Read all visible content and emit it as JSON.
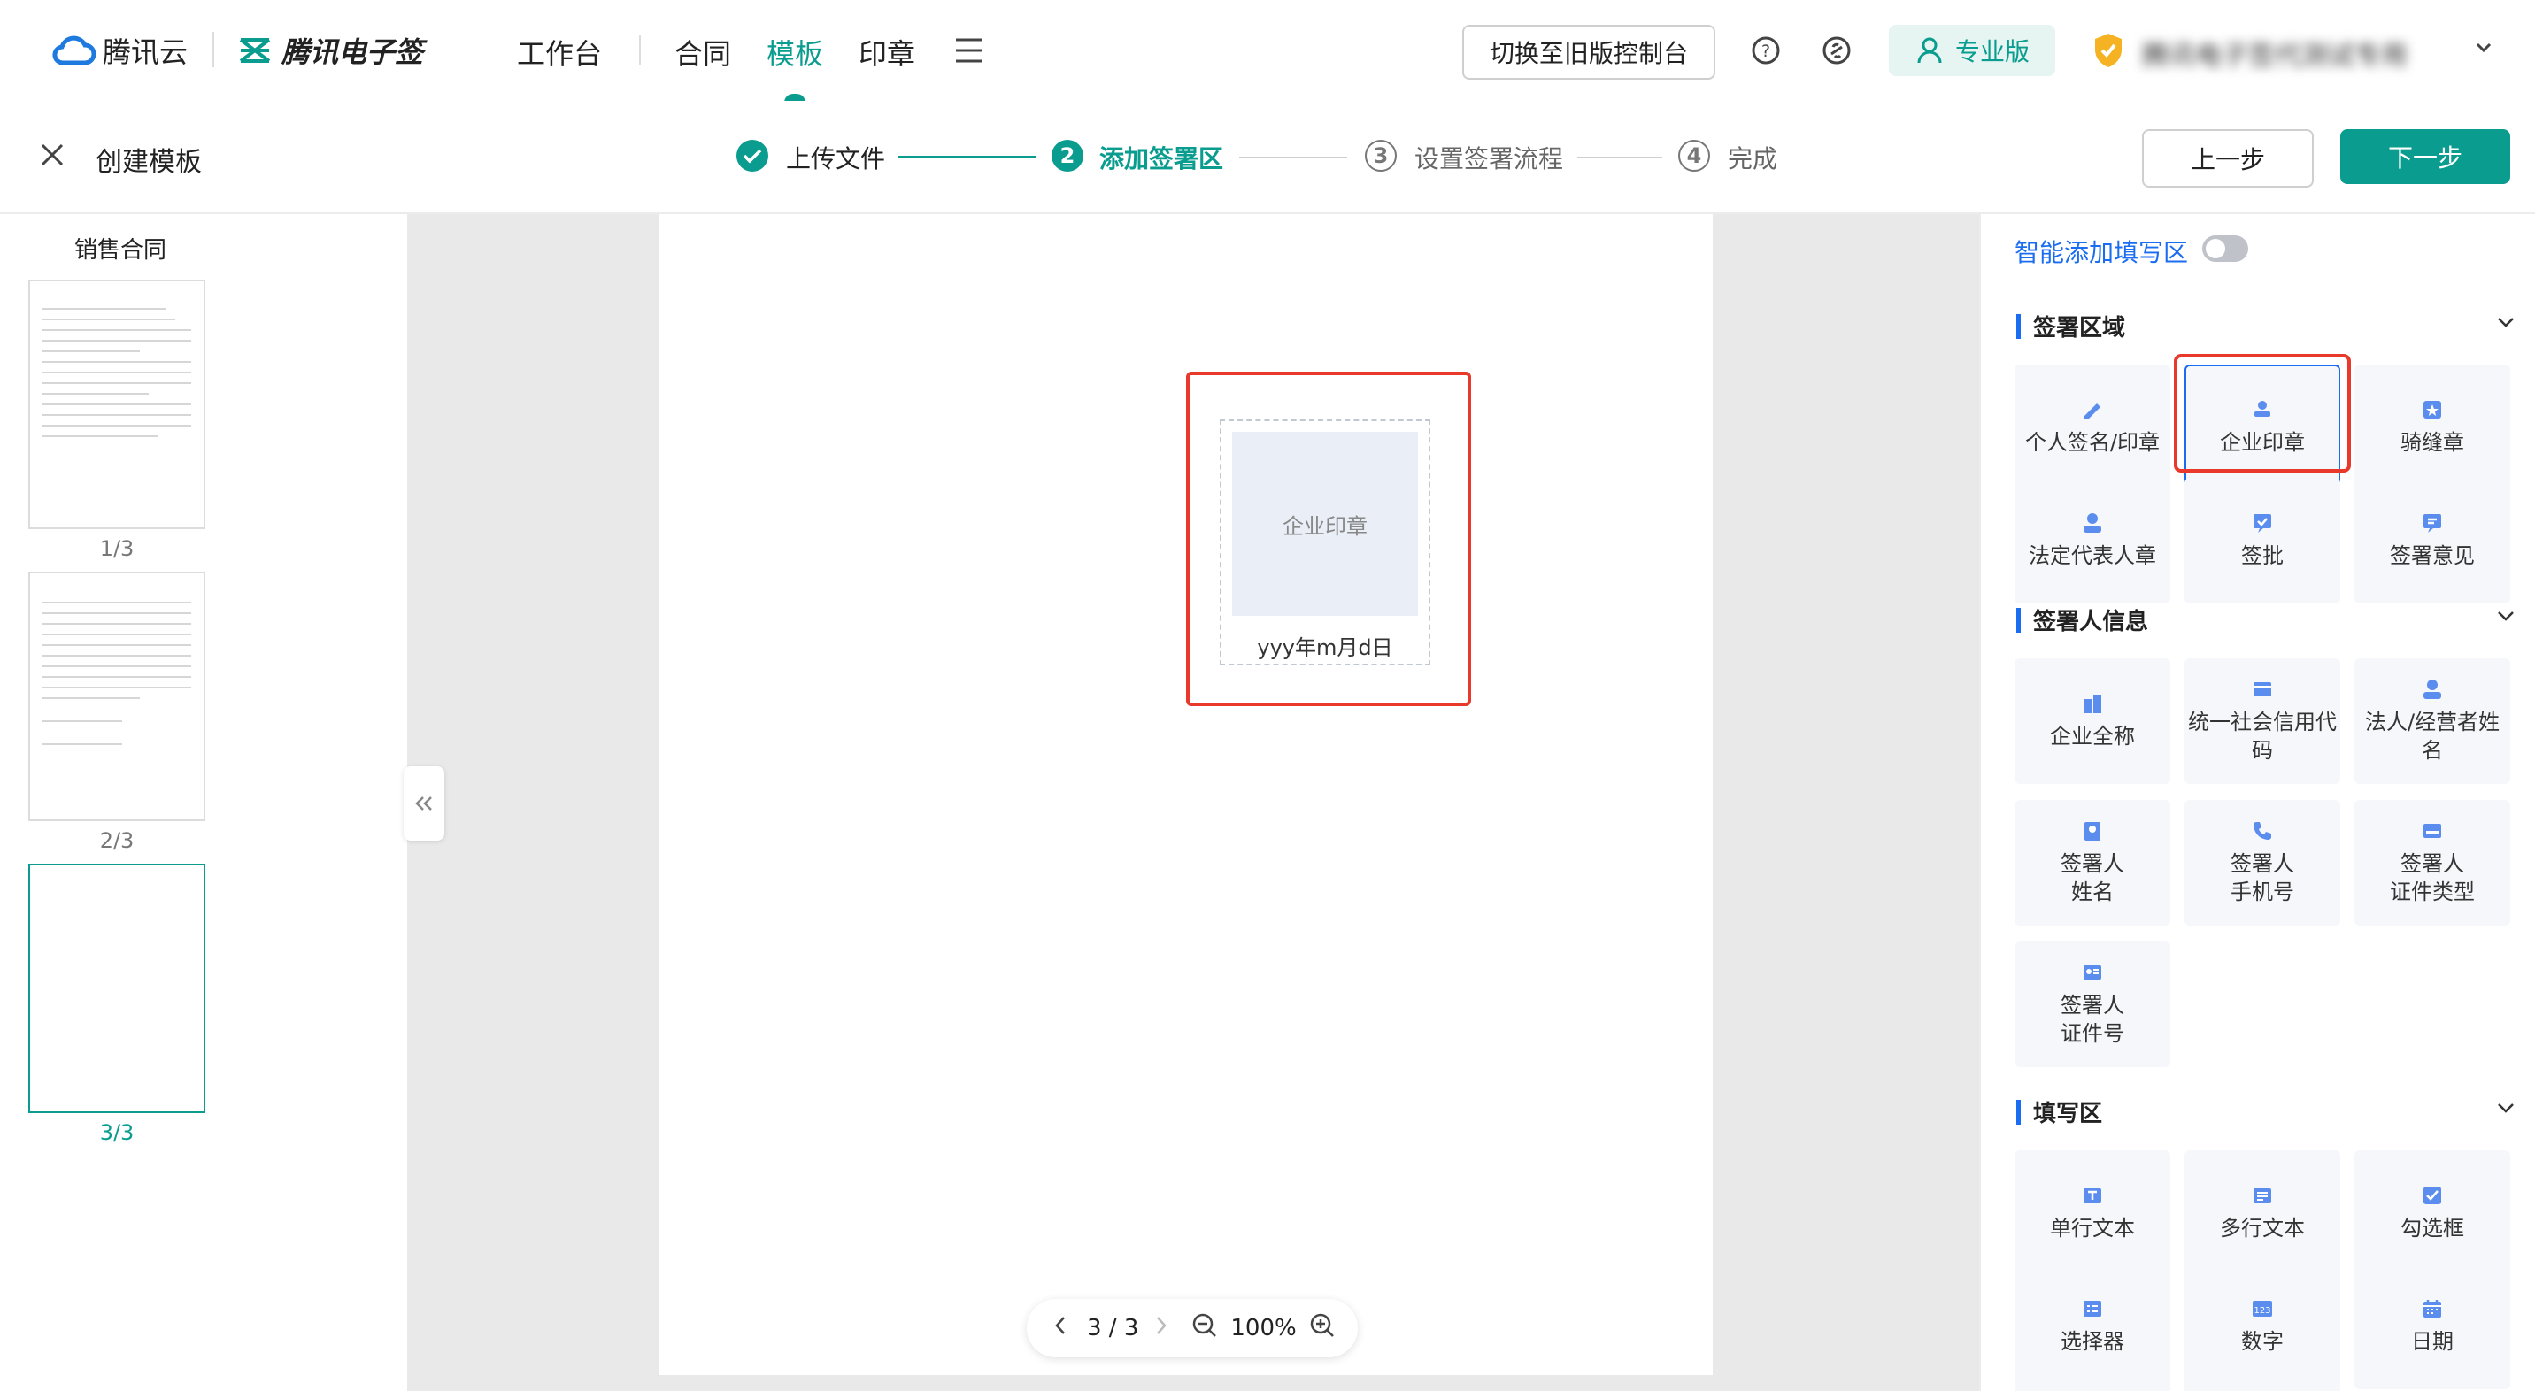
{
  "topbar": {
    "cloud_brand": "腾讯云",
    "esign_brand": "腾讯电子签",
    "nav": [
      "工作台",
      "合同",
      "模板",
      "印章"
    ],
    "active_nav": "模板",
    "switch_console": "切换至旧版控制台",
    "edition": "专业版",
    "org_name": "腾讯电子签代测试专用"
  },
  "subbar": {
    "title": "创建模板",
    "steps": [
      {
        "num": "1",
        "label": "上传文件",
        "state": "done"
      },
      {
        "num": "2",
        "label": "添加签署区",
        "state": "active"
      },
      {
        "num": "3",
        "label": "设置签署流程",
        "state": "todo"
      },
      {
        "num": "4",
        "label": "完成",
        "state": "todo"
      }
    ],
    "prev": "上一步",
    "next": "下一步"
  },
  "left": {
    "doc_name": "销售合同",
    "pages": [
      "1/3",
      "2/3",
      "3/3"
    ],
    "active_page": "3/3"
  },
  "canvas": {
    "seal_placeholder": "企业印章",
    "date_format": "yyy年m月d日",
    "pager": {
      "page": "3 / 3",
      "zoom": "100%"
    }
  },
  "right": {
    "smart_fill": "智能添加填写区",
    "smart_fill_on": false,
    "sections": [
      {
        "title": "签署区域",
        "items": [
          "个人签名/印章",
          "企业印章",
          "骑缝章",
          "法定代表人章",
          "签批",
          "签署意见"
        ],
        "icons": [
          "pen-icon",
          "seal-icon",
          "stamp-icon",
          "person-icon",
          "approve-icon",
          "comment-icon"
        ]
      },
      {
        "title": "签署人信息",
        "items": [
          "企业全称",
          "统一社会信用代码",
          "法人/经营者姓名",
          "签署人\n姓名",
          "签署人\n手机号",
          "签署人\n证件类型",
          "签署人\n证件号"
        ],
        "icons": [
          "building-icon",
          "card-icon",
          "person-icon",
          "id-badge-icon",
          "phone-icon",
          "id-card-icon",
          "id-number-icon"
        ]
      },
      {
        "title": "填写区",
        "items": [
          "单行文本",
          "多行文本",
          "勾选框",
          "选择器",
          "数字",
          "日期"
        ],
        "icons": [
          "text-icon",
          "textarea-icon",
          "checkbox-icon",
          "select-icon",
          "number-icon",
          "calendar-icon"
        ]
      }
    ],
    "highlighted_item": "企业印章"
  },
  "colors": {
    "accent": "#0a9d8f",
    "blue": "#1a6cf0",
    "highlight": "#e8392b"
  }
}
